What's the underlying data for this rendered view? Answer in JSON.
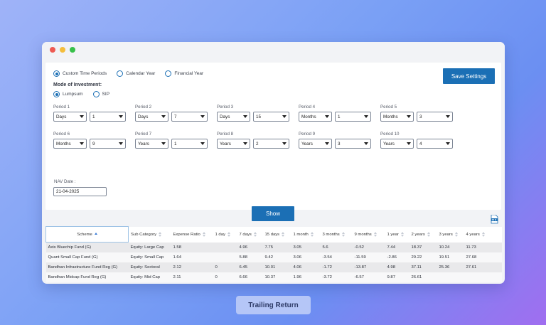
{
  "time_mode": {
    "options": [
      "Custom Time Periods",
      "Calendar Year",
      "Financial Year"
    ],
    "selected": "Custom Time Periods"
  },
  "investment_mode": {
    "label": "Mode of Investment:",
    "options": [
      "Lumpsum",
      "SIP"
    ],
    "selected": "Lumpsum"
  },
  "buttons": {
    "save": "Save Settings",
    "show": "Show"
  },
  "periods": [
    {
      "label": "Period 1",
      "unit": "Days",
      "value": "1"
    },
    {
      "label": "Period 2",
      "unit": "Days",
      "value": "7"
    },
    {
      "label": "Period 3",
      "unit": "Days",
      "value": "15"
    },
    {
      "label": "Period 4",
      "unit": "Months",
      "value": "1"
    },
    {
      "label": "Period 5",
      "unit": "Months",
      "value": "3"
    },
    {
      "label": "Period 6",
      "unit": "Months",
      "value": "9"
    },
    {
      "label": "Period 7",
      "unit": "Years",
      "value": "1"
    },
    {
      "label": "Period 8",
      "unit": "Years",
      "value": "2"
    },
    {
      "label": "Period 9",
      "unit": "Years",
      "value": "3"
    },
    {
      "label": "Period 10",
      "unit": "Years",
      "value": "4"
    }
  ],
  "nav": {
    "label": "NAV Date :",
    "value": "21-04-2025"
  },
  "table": {
    "columns": [
      "Scheme",
      "Sub Category",
      "Expense Ratio",
      "1 day",
      "7 days",
      "15 days",
      "1 month",
      "3 months",
      "9 months",
      "1 year",
      "2 years",
      "3 years",
      "4 years"
    ],
    "rows": [
      [
        "Axis Bluechip Fund (G)",
        "Equity: Large Cap",
        "1.58",
        "",
        "4.96",
        "7.75",
        "3.05",
        "5.6",
        "-0.52",
        "7.44",
        "18.37",
        "10.24",
        "11.73"
      ],
      [
        "Quant Small Cap Fund (G)",
        "Equity: Small Cap",
        "1.64",
        "",
        "5.88",
        "9.42",
        "3.06",
        "-3.54",
        "-11.59",
        "-2.86",
        "29.22",
        "19.51",
        "27.68"
      ],
      [
        "Bandhan Infrastructure Fund Reg (G)",
        "Equity: Sectoral",
        "2.12",
        "0",
        "6.45",
        "10.01",
        "4.06",
        "-1.72",
        "-13.87",
        "4.98",
        "37.11",
        "25.36",
        "27.61"
      ],
      [
        "Bandhan Midcap Fund Reg (G)",
        "Equity: Mid Cap",
        "2.11",
        "0",
        "6.66",
        "10.37",
        "1.96",
        "-3.72",
        "-6.57",
        "9.87",
        "26.61",
        "",
        ""
      ]
    ]
  },
  "caption": "Trailing Return",
  "colors": {
    "accent": "#1b6fb5"
  }
}
